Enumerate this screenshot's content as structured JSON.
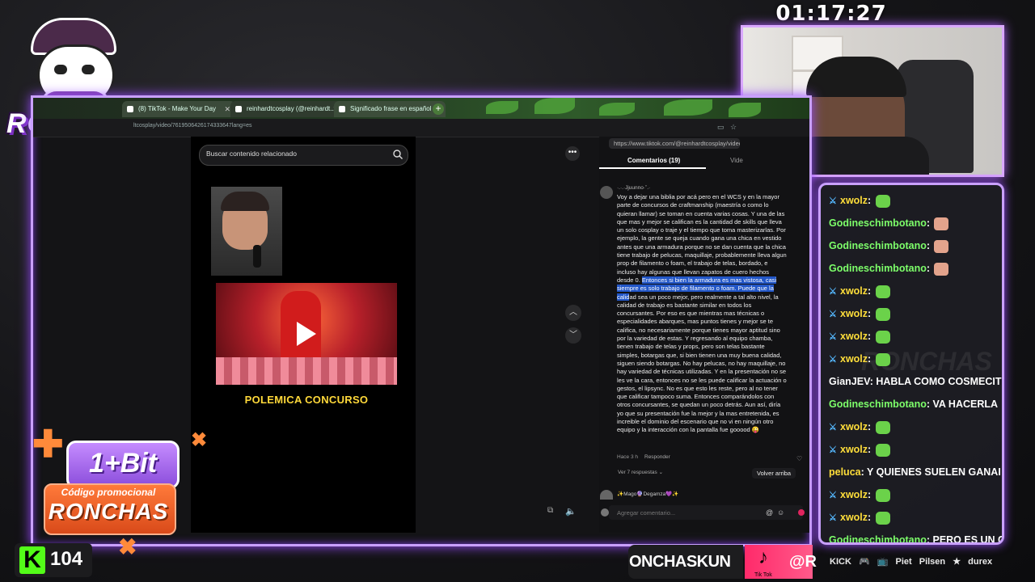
{
  "overlay": {
    "logo_text": "RONCHAS",
    "timer": "01:17:27",
    "promo_brand": "1+Bit",
    "promo_label": "Código promocional",
    "promo_code": "RONCHAS",
    "viewer_count": "104",
    "ticker_text": "ONCHASKUN",
    "tiktok_at": "@R",
    "tiktok_small": "Tik Tok",
    "kick_k": "K",
    "chat_watermark": "RONCHAS",
    "sponsors": [
      "KICK",
      "🎮",
      "📺",
      "Piet",
      "Pilsen",
      "★",
      "durex"
    ]
  },
  "browser": {
    "tabs": [
      {
        "label": "(8) TikTok - Make Your Day"
      },
      {
        "label": "reinhardtcosplay (@reinhardt..."
      },
      {
        "label": "Significado frase en español"
      }
    ],
    "url": "ltcosplay/video/7619506426174333647lang=es"
  },
  "tiktok": {
    "search_placeholder": "Buscar contenido relacionado",
    "video_caption": "POLEMICA CONCURSO",
    "page_url": "https://www.tiktok.com/@reinhardtcosplay/video",
    "tab_comments": "Comentarios (19)",
    "tab_videos": "Vide",
    "comment": {
      "user": "·.·.·Jjuunno·˚.·",
      "body_before": "Voy a dejar una biblia por acá pero en el WCS y en la mayor parte de concursos de craftmanship (maestría o como lo quieran llamar) se toman en cuenta varias cosas. Y una de las que mas y mejor se califican es la cantidad de skills que lleva un solo cosplay o traje y el tiempo que toma masterizarlas. Por ejemplo, la gente se queja cuando gana una chica en vestido antes que una armadura porque no se dan cuenta que la chica tiene trabajo de pelucas, maquillaje, probablemente lleva algun prop de filamento o foam, el trabajo de telas, bordado, e incluso hay algunas que llevan zapatos de cuero hechos desde 0. ",
      "body_highlight": "Entonces si bien la armadura es mas vistosa, casi siempre es solo trabajo de filamento o foam. Puede que la calid",
      "body_after": "ad sea un poco mejor, pero realmente a tal alto nivel, la calidad de trabajo es bastante similar en todos los concursantes. Por eso es que mientras mas técnicas o especialidades abarques, mas puntos tienes y mejor se te califica, no necesariamente porque tienes mayor aptitud sino por la variedad de estas. Y regresando al equipo chamba, tienen trabajo de telas y props, pero son telas bastante simples, botargas que, si bien tienen una muy buena calidad, siguen siendo botargas. No hay pelucas, no hay maquillaje, no hay variedad de técnicas utilizadas. Y en la presentación no se les ve la cara, entonces no se les puede calificar la actuación o gestos, el lipsync. No es que esto les reste, pero al no tener que calificar tampoco suma. Entonces comparándolos con otros concursantes, se quedan un poco detrás. Aun así, diría yo que su presentación fue la mejor y la mas entretenida, es increible el dominio del escenario que no vi en ningún otro equipo y la interacción con la pantalla fue gooood 😜",
      "time": "Hace 3 h",
      "reply": "Responder",
      "view_replies": "Ver 7 respuestas ⌄"
    },
    "back_to_top": "Volver arriba",
    "next_user": "✨Mago🔮Degamza💜✨",
    "input_placeholder": "Agregar comentario..."
  },
  "chat": [
    {
      "user": "xwolz",
      "msg": "",
      "emote": "frog",
      "mod": true
    },
    {
      "user": "Godineschimbotano",
      "msg": "",
      "emote": "face",
      "mod": false
    },
    {
      "user": "Godineschimbotano",
      "msg": "",
      "emote": "face",
      "mod": false
    },
    {
      "user": "Godineschimbotano",
      "msg": "",
      "emote": "face",
      "mod": false
    },
    {
      "user": "xwolz",
      "msg": "",
      "emote": "frog",
      "mod": true
    },
    {
      "user": "xwolz",
      "msg": "",
      "emote": "frog",
      "mod": true
    },
    {
      "user": "xwolz",
      "msg": "",
      "emote": "frog",
      "mod": true
    },
    {
      "user": "xwolz",
      "msg": "",
      "emote": "frog",
      "mod": true
    },
    {
      "user": "GianJEV",
      "msg": "HABLA COMO COSMECIT",
      "emote": "",
      "mod": false
    },
    {
      "user": "Godineschimbotano",
      "msg": "VA HACERLA",
      "emote": "",
      "mod": false
    },
    {
      "user": "xwolz",
      "msg": "",
      "emote": "frog",
      "mod": true
    },
    {
      "user": "xwolz",
      "msg": "",
      "emote": "frog",
      "mod": true
    },
    {
      "user": "peluca",
      "msg": "Y QUIENES SUELEN GANAI",
      "emote": "",
      "mod": false
    },
    {
      "user": "xwolz",
      "msg": "",
      "emote": "frog",
      "mod": true
    },
    {
      "user": "xwolz",
      "msg": "",
      "emote": "frog",
      "mod": true
    },
    {
      "user": "Godineschimbotano",
      "msg": "PERO ES UN C",
      "emote": "",
      "mod": false
    }
  ]
}
